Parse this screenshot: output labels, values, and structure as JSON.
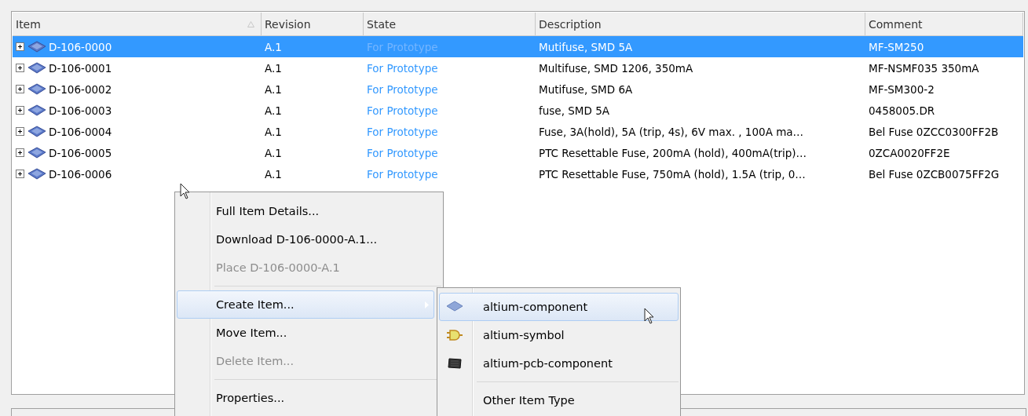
{
  "table": {
    "columns": [
      {
        "label": "Item",
        "sorted": true
      },
      {
        "label": "Revision",
        "sorted": false
      },
      {
        "label": "State",
        "sorted": false
      },
      {
        "label": "Description",
        "sorted": false
      },
      {
        "label": "Comment",
        "sorted": false
      }
    ],
    "rows": [
      {
        "item": "D-106-0000",
        "revision": "A.1",
        "state": "For Prototype",
        "description": "Mutifuse, SMD 5A",
        "comment": "MF-SM250",
        "selected": true,
        "expanded": false
      },
      {
        "item": "D-106-0001",
        "revision": "A.1",
        "state": "For Prototype",
        "description": "Multifuse, SMD 1206, 350mA",
        "comment": "MF-NSMF035 350mA",
        "selected": false,
        "expanded": false
      },
      {
        "item": "D-106-0002",
        "revision": "A.1",
        "state": "For Prototype",
        "description": "Mutifuse, SMD 6A",
        "comment": "MF-SM300-2",
        "selected": false,
        "expanded": false
      },
      {
        "item": "D-106-0003",
        "revision": "A.1",
        "state": "For Prototype",
        "description": "fuse, SMD 5A",
        "comment": "0458005.DR",
        "selected": false,
        "expanded": false
      },
      {
        "item": "D-106-0004",
        "revision": "A.1",
        "state": "For Prototype",
        "description": "Fuse, 3A(hold), 5A (trip, 4s), 6V max. , 100A ma…",
        "comment": "Bel Fuse 0ZCC0300FF2B",
        "selected": false,
        "expanded": false
      },
      {
        "item": "D-106-0005",
        "revision": "A.1",
        "state": "For Prototype",
        "description": "PTC Resettable Fuse, 200mA (hold), 400mA(trip)…",
        "comment": "0ZCA0020FF2E",
        "selected": false,
        "expanded": false
      },
      {
        "item": "D-106-0006",
        "revision": "A.1",
        "state": "For Prototype",
        "description": "PTC Resettable Fuse, 750mA (hold), 1.5A (trip, 0…",
        "comment": "Bel Fuse 0ZCB0075FF2G",
        "selected": false,
        "expanded": false
      }
    ]
  },
  "context_menu": {
    "items": [
      {
        "kind": "item",
        "label": "Full Item Details...",
        "disabled": false,
        "highlighted": false,
        "submenu": false
      },
      {
        "kind": "item",
        "label": "Download D-106-0000-A.1...",
        "disabled": false,
        "highlighted": false,
        "submenu": false
      },
      {
        "kind": "item",
        "label": "Place D-106-0000-A.1",
        "disabled": true,
        "highlighted": false,
        "submenu": false
      },
      {
        "kind": "separator"
      },
      {
        "kind": "item",
        "label": "Create Item...",
        "disabled": false,
        "highlighted": true,
        "submenu": true
      },
      {
        "kind": "item",
        "label": "Move Item...",
        "disabled": false,
        "highlighted": false,
        "submenu": false
      },
      {
        "kind": "item",
        "label": "Delete Item...",
        "disabled": true,
        "highlighted": false,
        "submenu": false
      },
      {
        "kind": "separator"
      },
      {
        "kind": "item",
        "label": "Properties...",
        "disabled": false,
        "highlighted": false,
        "submenu": false
      }
    ]
  },
  "submenu": {
    "items": [
      {
        "kind": "component",
        "label": "altium-component",
        "highlighted": true
      },
      {
        "kind": "symbol",
        "label": "altium-symbol",
        "highlighted": false
      },
      {
        "kind": "pcb",
        "label": "altium-pcb-component",
        "highlighted": false
      },
      {
        "kind": "separator"
      },
      {
        "kind": "plain",
        "label": "Other Item Type",
        "highlighted": false
      }
    ]
  }
}
